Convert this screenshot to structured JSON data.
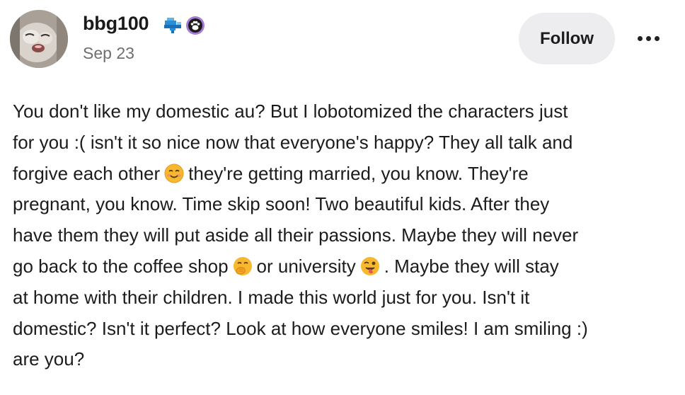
{
  "post": {
    "username": "bbg100",
    "date": "Sep 23",
    "follow_label": "Follow",
    "badges": [
      "cloud-badge-icon",
      "paw-badge-icon"
    ],
    "body_lines": [
      {
        "parts": [
          {
            "text": "You don't like my domestic au? But I lobotomized the characters just"
          }
        ]
      },
      {
        "parts": [
          {
            "text": "for you :( isn't it so nice now that everyone's happy? They all talk and"
          }
        ]
      },
      {
        "parts": [
          {
            "text": "forgive each other"
          },
          {
            "emoji": "smiling-face-emoji"
          },
          {
            "text": "they're getting married, you know.  They're"
          }
        ]
      },
      {
        "parts": [
          {
            "text": "pregnant, you know.  Time skip soon! Two beautiful kids.  After they"
          }
        ]
      },
      {
        "parts": [
          {
            "text": "have them they will put aside all their passions.  Maybe they will never"
          }
        ]
      },
      {
        "parts": [
          {
            "text": "go back to the coffee shop"
          },
          {
            "emoji": "hand-over-mouth-emoji"
          },
          {
            "text": "or university"
          },
          {
            "emoji": "winking-tongue-emoji"
          },
          {
            "text": ".  Maybe they will stay"
          }
        ]
      },
      {
        "parts": [
          {
            "text": "at home with their children.  I made this world just for you.  Isn't it"
          }
        ]
      },
      {
        "parts": [
          {
            "text": "domestic? Isn't it perfect? Look at how everyone smiles! I am smiling :)"
          }
        ]
      },
      {
        "parts": [
          {
            "text": "are you?"
          }
        ]
      }
    ]
  }
}
